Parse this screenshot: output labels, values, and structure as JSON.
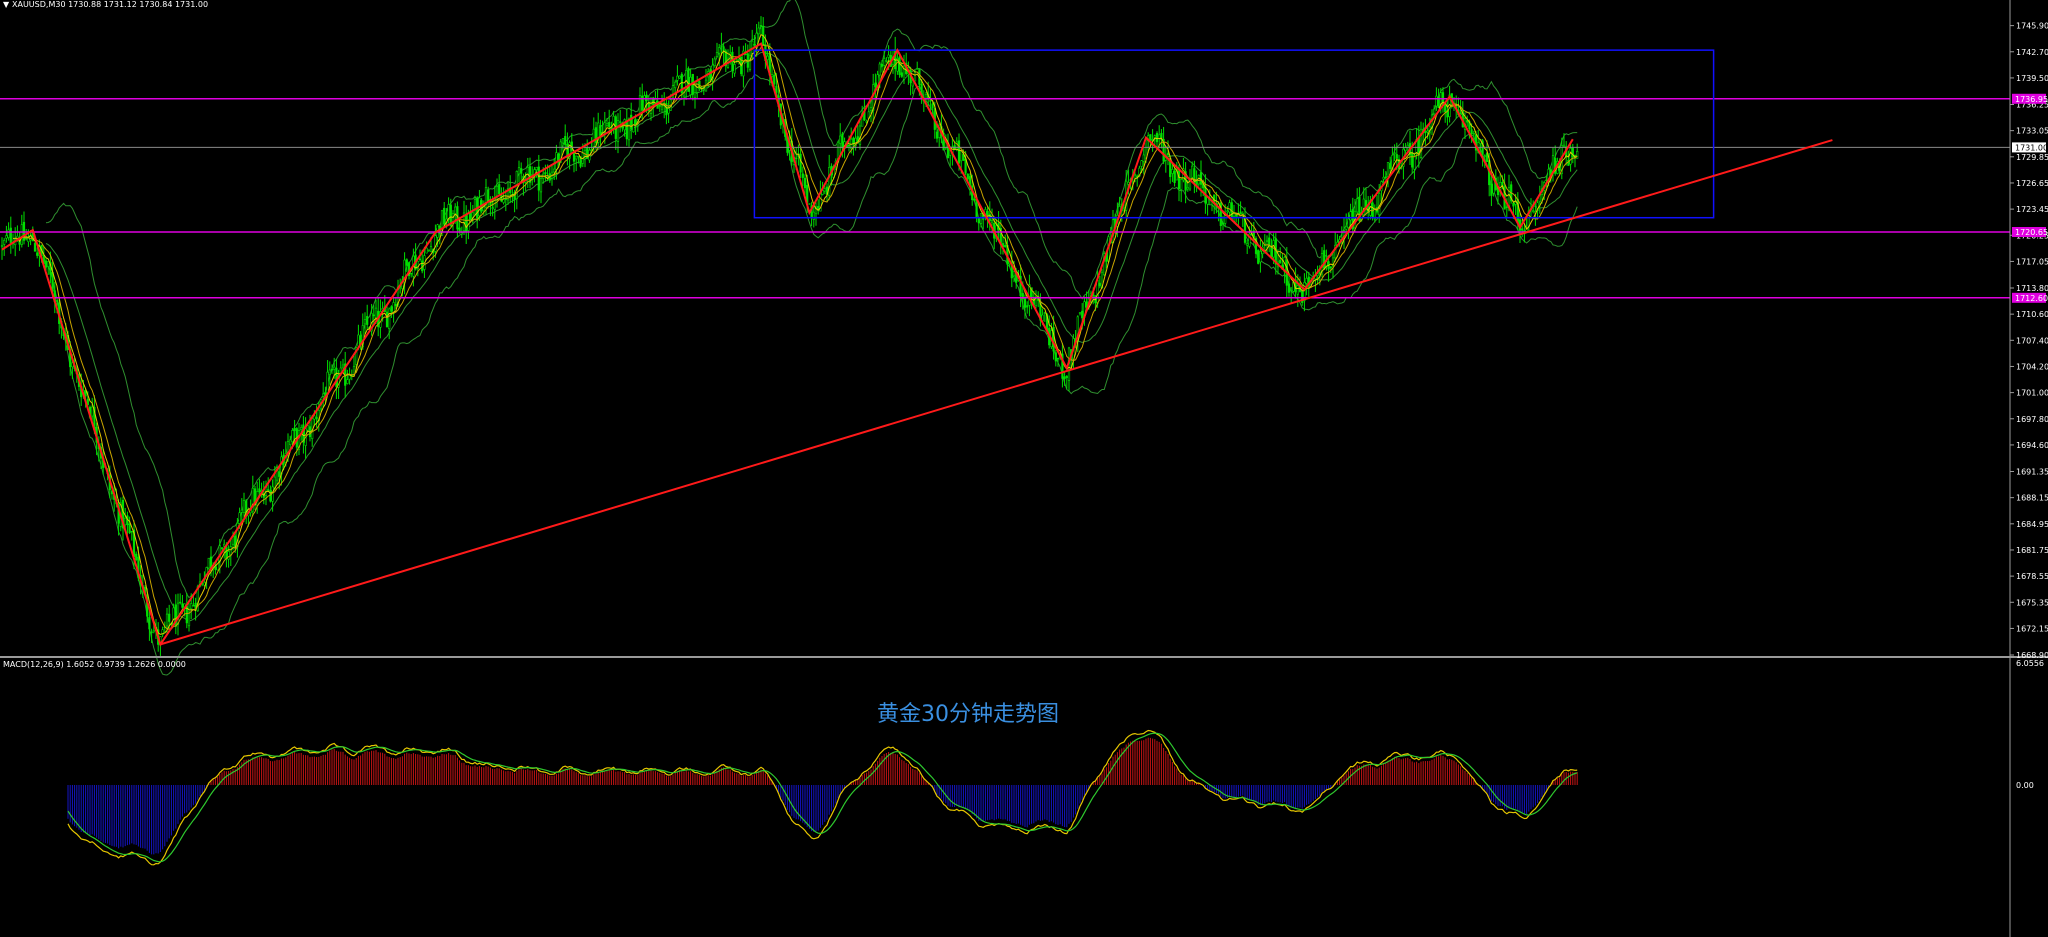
{
  "symbol_info": "XAUUSD,M30  1730.88 1731.12 1730.84 1731.00",
  "macd_info": "MACD(12,26,9) 1.6052 0.9739 1.2626 0.0000",
  "caption": "黄金30分钟走势图",
  "colors": {
    "background": "#000000",
    "candle": "#00e000",
    "zigzag": "#ff1a1a",
    "trendline": "#ff1a1a",
    "horizontal": "#e000e0",
    "rectangle": "#1010ff",
    "bands": "#2f8f2f",
    "ma": "#e6c700",
    "macd_up": "#c41414",
    "macd_down": "#1414c4",
    "axis_text": "#ffffff",
    "caption": "#3a8fe0"
  },
  "chart_data": [
    {
      "type": "candlestick",
      "title": "XAUUSD,M30",
      "ylim": [
        1668.9,
        1748.3
      ],
      "y_ticks": [
        "1745.90",
        "1742.70",
        "1739.50",
        "1736.25",
        "1733.05",
        "1729.85",
        "1726.65",
        "1723.45",
        "1720.25",
        "1717.05",
        "1713.80",
        "1710.60",
        "1707.40",
        "1704.20",
        "1701.00",
        "1697.80",
        "1694.60",
        "1691.35",
        "1688.15",
        "1684.95",
        "1681.75",
        "1678.55",
        "1675.35",
        "1672.15",
        "1668.90"
      ],
      "price_labels": [
        "1736.95",
        "1731.00",
        "1720.65",
        "1712.60"
      ],
      "current_price": 1731.0,
      "horizontal_levels": [
        1736.95,
        1720.65,
        1712.6
      ],
      "zigzag": [
        {
          "bar": 0,
          "price": 1718.5
        },
        {
          "bar": 14,
          "price": 1720.9
        },
        {
          "bar": 72,
          "price": 1670.2
        },
        {
          "bar": 197,
          "price": 1720.6
        },
        {
          "bar": 345,
          "price": 1743.7
        },
        {
          "bar": 367,
          "price": 1723.0
        },
        {
          "bar": 407,
          "price": 1742.9
        },
        {
          "bar": 484,
          "price": 1704.0
        },
        {
          "bar": 520,
          "price": 1732.2
        },
        {
          "bar": 592,
          "price": 1713.6
        },
        {
          "bar": 658,
          "price": 1737.2
        },
        {
          "bar": 690,
          "price": 1721.2
        },
        {
          "bar": 714,
          "price": 1732.0
        }
      ],
      "trendline": {
        "from": {
          "bar": 72,
          "price": 1670.2
        },
        "to": {
          "bar": 832,
          "price": 1731.9
        }
      },
      "rectangle": {
        "bar_start": 342,
        "bar_end": 778,
        "price_low": 1722.4,
        "price_high": 1742.9
      }
    },
    {
      "type": "macd",
      "title": "MACD(12,26,9)",
      "params": [
        12,
        26,
        9
      ],
      "values": {
        "macd": 1.6052,
        "signal": 0.9739,
        "histogram": 1.2626,
        "extra": 0.0
      },
      "y_ticks": [
        "6.0556",
        "0.00"
      ]
    }
  ]
}
